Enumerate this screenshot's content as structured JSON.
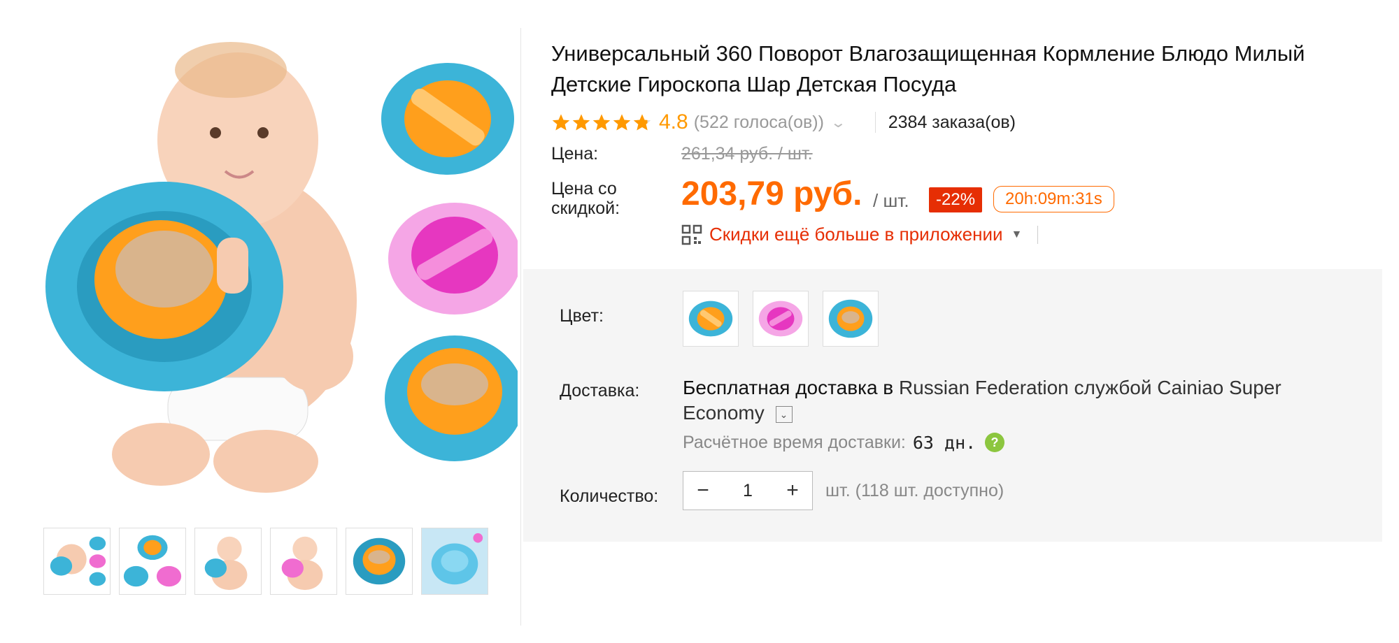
{
  "product": {
    "title": "Универсальный 360 Поворот Влагозащищенная Кормление Блюдо Милый Детские Гироскопа Шар Детская Посуда"
  },
  "rating": {
    "stars": 4.8,
    "value": "4.8",
    "votes": "(522 голоса(ов))",
    "orders": "2384 заказа(ов)"
  },
  "price": {
    "label": "Цена:",
    "original": "261,34 руб. / шт.",
    "discount_label": "Цена со скидкой:",
    "current": "203,79 руб.",
    "unit": "/ шт.",
    "discount_badge": "-22%",
    "timer": "20h:09m:31s",
    "app_promo": "Скидки ещё больше в приложении"
  },
  "options": {
    "color_label": "Цвет:",
    "colors": [
      "orange-blue",
      "pink",
      "blue-orange"
    ]
  },
  "shipping": {
    "label": "Доставка:",
    "free_text": "Бесплатная доставка в",
    "destination_service": "Russian Federation службой Cainiao Super Economy",
    "eta_label": "Расчётное время доставки:",
    "eta_value": "63 дн."
  },
  "quantity": {
    "label": "Количество:",
    "value": "1",
    "minus": "−",
    "plus": "+",
    "available": "шт. (118 шт. доступно)"
  },
  "colors": {
    "accent": "#ff6a00",
    "badge": "#e62e04",
    "star": "#ff9900",
    "bowl_blue": "#3cb4d8",
    "bowl_orange": "#ff9f1c",
    "bowl_pink": "#f06cd0"
  },
  "thumbnails": [
    "baby-with-bowls",
    "three-bowls",
    "baby-blue-bowl",
    "baby-pink-bowl",
    "blue-bowl-closeup",
    "blue-bowl-light"
  ]
}
